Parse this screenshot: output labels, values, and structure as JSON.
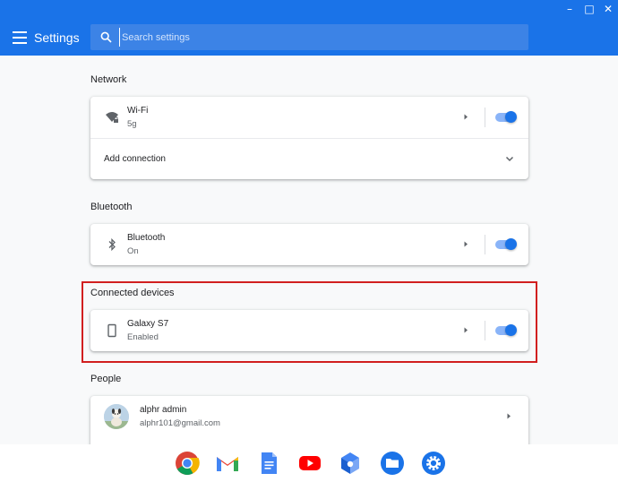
{
  "window": {
    "minimize": "–",
    "maximize": "□",
    "close": "✕"
  },
  "header": {
    "title": "Settings",
    "search_placeholder": "Search settings"
  },
  "network": {
    "title": "Network",
    "wifi": {
      "label": "Wi-Fi",
      "status": "5g",
      "enabled": true
    },
    "add_connection": "Add connection"
  },
  "bluetooth": {
    "title": "Bluetooth",
    "item": {
      "label": "Bluetooth",
      "status": "On",
      "enabled": true
    }
  },
  "connected_devices": {
    "title": "Connected devices",
    "item": {
      "label": "Galaxy S7",
      "status": "Enabled",
      "enabled": true
    }
  },
  "people": {
    "title": "People",
    "user": {
      "name": "alphr admin",
      "email": "alphr101@gmail.com"
    }
  },
  "shelf": {
    "apps": [
      "chrome-icon",
      "gmail-icon",
      "docs-icon",
      "youtube-icon",
      "app-icon",
      "files-icon",
      "settings-icon"
    ]
  },
  "colors": {
    "accent": "#1a73e8",
    "highlight": "#d11f1f"
  }
}
